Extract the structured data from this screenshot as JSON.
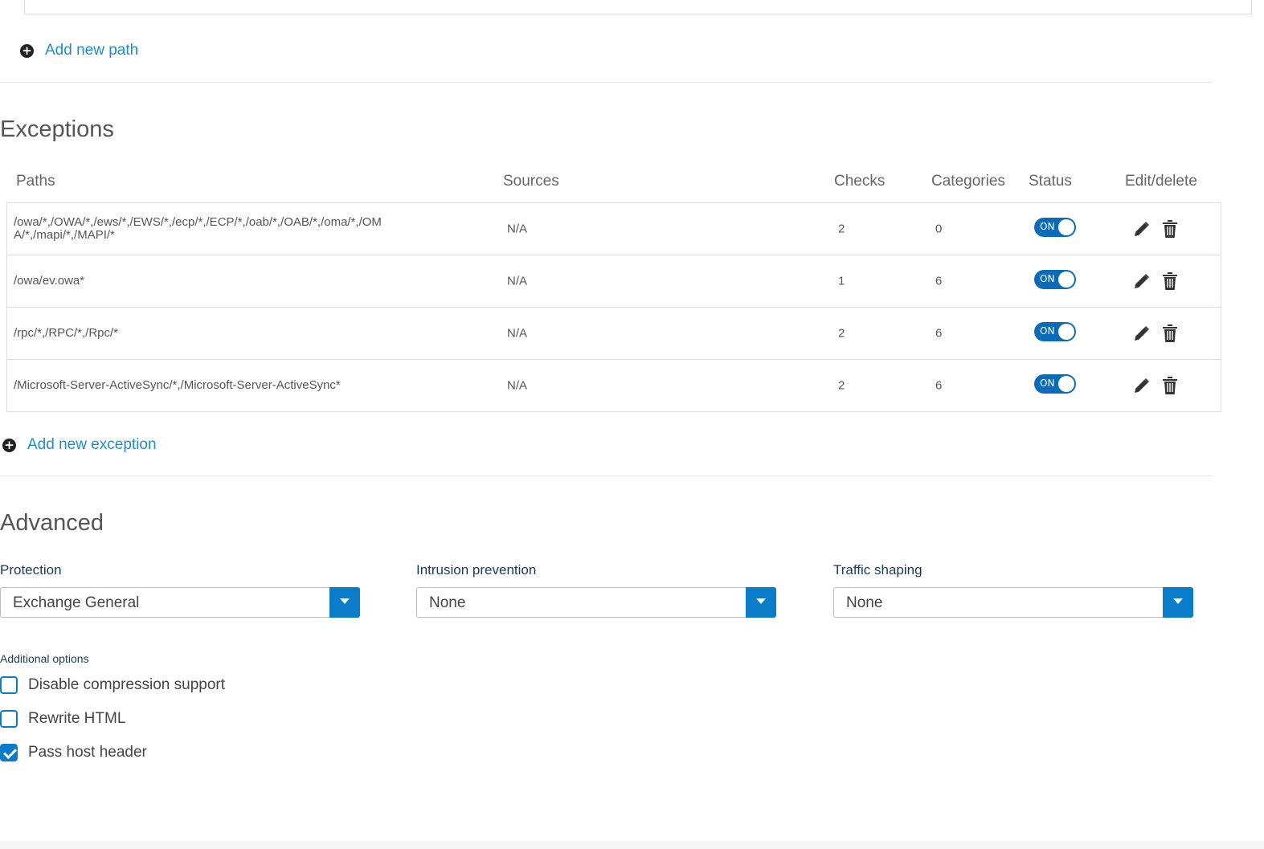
{
  "paths_section": {
    "add_label": "Add new path"
  },
  "exceptions": {
    "title": "Exceptions",
    "headers": {
      "paths": "Paths",
      "sources": "Sources",
      "checks": "Checks",
      "categories": "Categories",
      "status": "Status",
      "edit_delete": "Edit/delete"
    },
    "rows": [
      {
        "path": "/owa/*,/OWA/*,/ews/*,/EWS/*,/ecp/*,/ECP/*,/oab/*,/OAB/*,/oma/*,/OMA/*,/mapi/*,/MAPI/*",
        "sources": "N/A",
        "checks": "2",
        "categories": "0",
        "status": "ON"
      },
      {
        "path": "/owa/ev.owa*",
        "sources": "N/A",
        "checks": "1",
        "categories": "6",
        "status": "ON"
      },
      {
        "path": "/rpc/*,/RPC/*,/Rpc/*",
        "sources": "N/A",
        "checks": "2",
        "categories": "6",
        "status": "ON"
      },
      {
        "path": "/Microsoft-Server-ActiveSync/*,/Microsoft-Server-ActiveSync*",
        "sources": "N/A",
        "checks": "2",
        "categories": "6",
        "status": "ON"
      }
    ],
    "add_label": "Add new exception"
  },
  "advanced": {
    "title": "Advanced",
    "protection": {
      "label": "Protection",
      "value": "Exchange General"
    },
    "intrusion": {
      "label": "Intrusion prevention",
      "value": "None"
    },
    "traffic": {
      "label": "Traffic shaping",
      "value": "None"
    },
    "additional_options_label": "Additional options",
    "options": [
      {
        "label": "Disable compression support",
        "checked": false
      },
      {
        "label": "Rewrite HTML",
        "checked": false
      },
      {
        "label": "Pass host header",
        "checked": true
      }
    ]
  },
  "colors": {
    "link": "#1a8fce",
    "accent": "#0a7cc9",
    "toggle_on": "#0b6bb8"
  }
}
